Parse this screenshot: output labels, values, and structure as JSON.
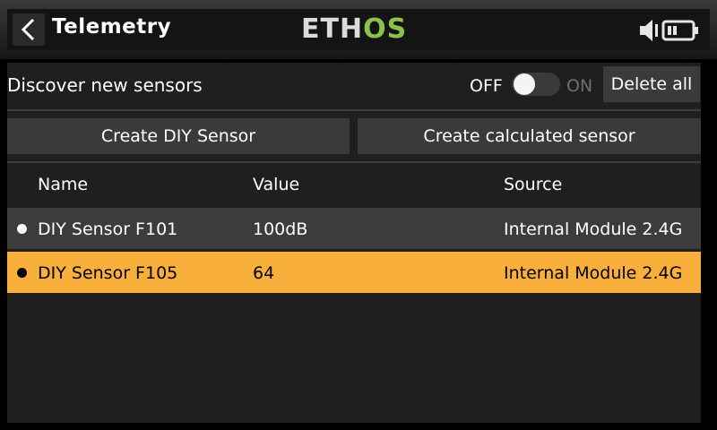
{
  "header": {
    "title": "Telemetry",
    "logo_left": "ETH",
    "logo_right": "OS",
    "icons": [
      "back-chevron-icon",
      "volume-icon",
      "battery-icon"
    ]
  },
  "discover": {
    "label": "Discover new sensors",
    "off_label": "OFF",
    "on_label": "ON",
    "state": "off"
  },
  "buttons": {
    "delete_all": "Delete all",
    "create_diy": "Create DIY Sensor",
    "create_calculated": "Create calculated sensor"
  },
  "table": {
    "columns": [
      "Name",
      "Value",
      "Source"
    ],
    "rows": [
      {
        "name": "DIY Sensor F101",
        "value": "100dB",
        "source": "Internal Module 2.4G",
        "selected": false
      },
      {
        "name": "DIY Sensor F105",
        "value": "64",
        "source": "Internal Module 2.4G",
        "selected": true
      }
    ]
  },
  "colors": {
    "accent": "#f9af3b",
    "logo_green": "#8bc34a"
  }
}
